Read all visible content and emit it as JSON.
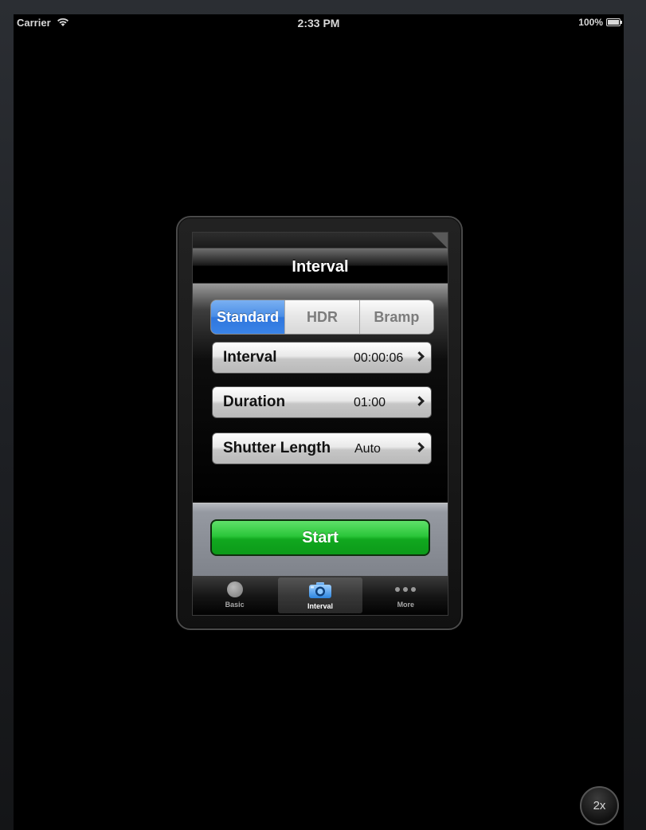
{
  "status_bar": {
    "carrier": "Carrier",
    "time": "2:33 PM",
    "battery": "100%"
  },
  "nav": {
    "title": "Interval"
  },
  "segments": [
    "Standard",
    "HDR",
    "Bramp"
  ],
  "selected_segment": "Standard",
  "rows": [
    {
      "label": "Interval",
      "value": "00:00:06"
    },
    {
      "label": "Duration",
      "value": "01:00"
    },
    {
      "label": "Shutter Length",
      "value": "Auto"
    }
  ],
  "start_button": "Start",
  "tabs": [
    {
      "label": "Basic",
      "icon": "circle-icon"
    },
    {
      "label": "Interval",
      "icon": "camera-icon",
      "active": true
    },
    {
      "label": "More",
      "icon": "more-dots-icon"
    }
  ],
  "zoom": "2x",
  "colors": {
    "accent_blue": "#3a84e8",
    "start_green": "#1fb82e"
  }
}
